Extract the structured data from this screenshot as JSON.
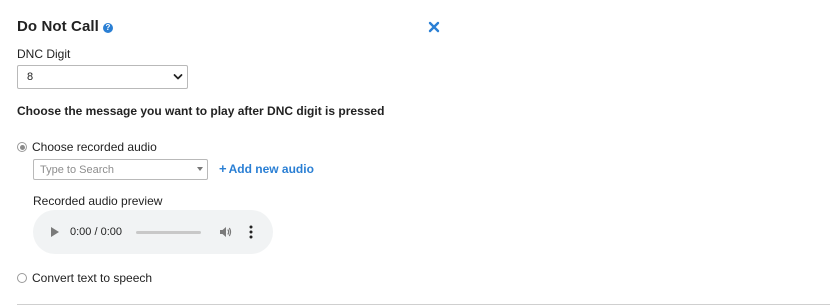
{
  "panel": {
    "title": "Do Not Call",
    "help_icon": "question-circle-icon",
    "close_icon": "close-x-icon",
    "accent_color": "#2a7fd4"
  },
  "dnc": {
    "label": "DNC Digit",
    "selected_value": "8"
  },
  "message": {
    "question": "Choose the message you want to play after DNC digit is pressed",
    "options": [
      {
        "label": "Choose recorded audio",
        "checked": true
      },
      {
        "label": "Convert text to speech",
        "checked": false
      }
    ]
  },
  "recorded_audio": {
    "search_placeholder": "Type to Search",
    "add_link": "Add new audio",
    "preview_label": "Recorded audio preview",
    "player": {
      "time": "0:00 / 0:00",
      "progress": 0
    }
  }
}
